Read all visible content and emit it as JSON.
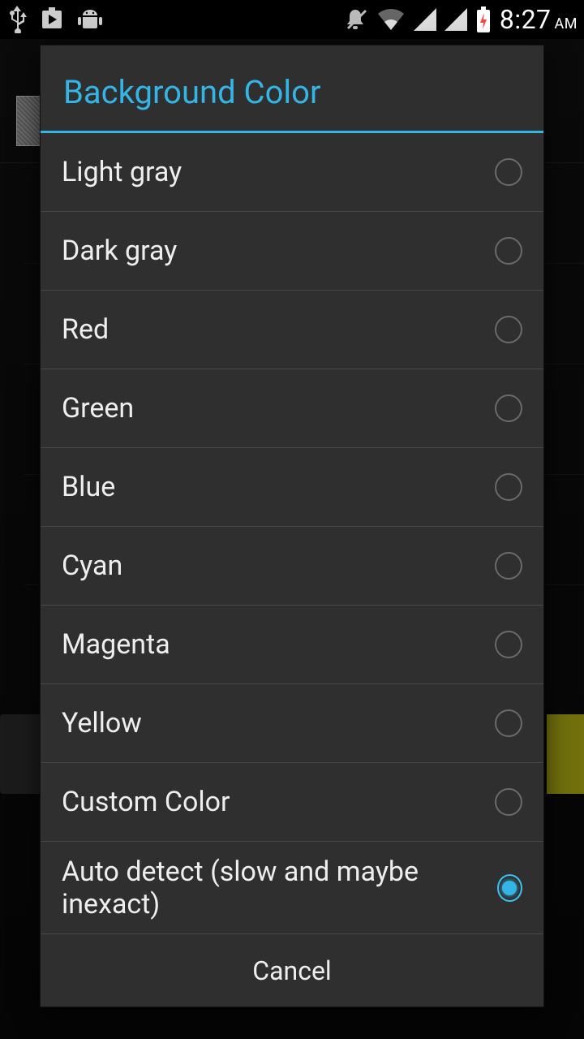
{
  "statusbar": {
    "time": "8:27",
    "ampm": "AM",
    "icons": {
      "usb": "usb-icon",
      "store": "play-store-icon",
      "android": "android-icon",
      "mute": "mute-icon",
      "wifi": "wifi-icon",
      "signal1": "signal-icon",
      "signal2": "signal-icon",
      "battery": "battery-charging-icon"
    }
  },
  "dialog": {
    "title": "Background Color",
    "options": [
      {
        "label": "Light gray",
        "selected": false
      },
      {
        "label": "Dark gray",
        "selected": false
      },
      {
        "label": "Red",
        "selected": false
      },
      {
        "label": "Green",
        "selected": false
      },
      {
        "label": "Blue",
        "selected": false
      },
      {
        "label": "Cyan",
        "selected": false
      },
      {
        "label": "Magenta",
        "selected": false
      },
      {
        "label": "Yellow",
        "selected": false
      },
      {
        "label": "Custom Color",
        "selected": false
      },
      {
        "label": "Auto detect (slow and maybe inexact)",
        "selected": true
      }
    ],
    "cancel_label": "Cancel"
  }
}
